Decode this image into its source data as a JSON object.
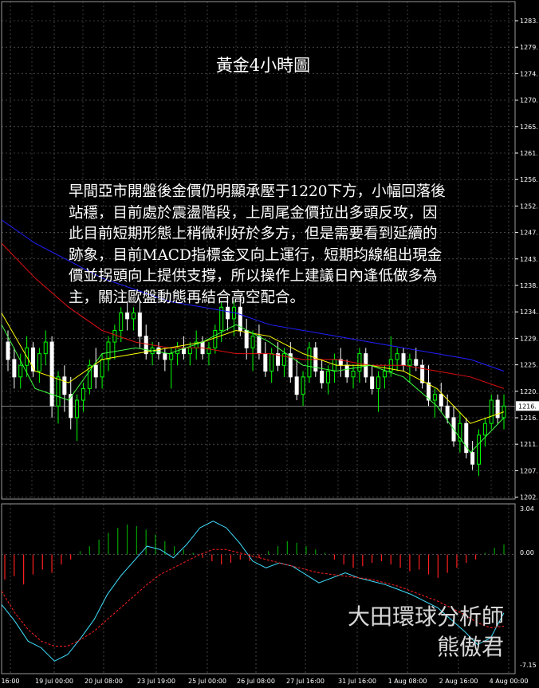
{
  "overlay": {
    "title": "黃金4小時圖",
    "commentary": "早間亞市開盤後金價仍明顯承壓于1220下方，小幅回落後\n站穩，目前處於震盪階段，上周尾金價拉出多頭反攻，因\n此目前短期形態上稍微利好於多方，但是需要看到延續的\n跡象，目前MACD指標金叉向上運行，短期均線組出現金\n價並拐頭向上提供支撐，所以操作上建議日內逢低做多為\n主，關注歐盤動態再結合高空配合。",
    "watermark_line1": "大田環球分析師",
    "watermark_line2": "熊傲君"
  },
  "colors": {
    "background": "#000000",
    "grid": "#707070",
    "bull_candle": "#00ff00",
    "bear_candle": "#ffffff",
    "ma_blue": "#2020ff",
    "ma_red": "#e01010",
    "ma_yellow": "#ffff00",
    "ma_green": "#40ff40",
    "macd_pos": "#00a000",
    "macd_neg": "#ff2020",
    "macd_main": "#40e0ff",
    "macd_signal": "#ff2020",
    "axis_text": "#ffffff",
    "current_price_line": "#c0c0c0"
  },
  "chart_data": {
    "type": "line",
    "price_axis": {
      "ticks": [
        "1283.",
        "1279.",
        "1274.",
        "1270.",
        "1265.",
        "1261.",
        "1256.",
        "1252.",
        "1247.",
        "1243.",
        "1238.",
        "1234.",
        "1229.",
        "1225.",
        "1220.",
        "1216.",
        "1211.",
        "1207.",
        "1202."
      ],
      "ylim": [
        1200,
        1285
      ],
      "current_price_label": "1216."
    },
    "macd_axis": {
      "ticks": [
        "3.04",
        "0.00",
        "-7.15"
      ],
      "ylim": [
        -7.15,
        3.04
      ]
    },
    "time_axis": [
      "16:00",
      "19 Jul 00:00",
      "20 Jul 08:00",
      "23 Jul 19:00",
      "25 Jul 00:00",
      "26 Jul 08:00",
      "27 Jul 16:00",
      "31 Jul 16:00",
      "1 Aug 08:00",
      "2 Aug 16:00",
      "4 Aug 00:00"
    ],
    "candles": [
      [
        1227,
        1229,
        1222,
        1224
      ],
      [
        1224,
        1226,
        1219,
        1221
      ],
      [
        1221,
        1225,
        1219,
        1223
      ],
      [
        1223,
        1228,
        1221,
        1226
      ],
      [
        1226,
        1227,
        1221,
        1222
      ],
      [
        1222,
        1226,
        1220,
        1225
      ],
      [
        1225,
        1229,
        1223,
        1227
      ],
      [
        1227,
        1228,
        1214,
        1216
      ],
      [
        1216,
        1222,
        1213,
        1221
      ],
      [
        1221,
        1223,
        1215,
        1218
      ],
      [
        1218,
        1221,
        1212,
        1214
      ],
      [
        1214,
        1218,
        1210,
        1217
      ],
      [
        1217,
        1220,
        1215,
        1219
      ],
      [
        1219,
        1224,
        1218,
        1223
      ],
      [
        1223,
        1226,
        1219,
        1221
      ],
      [
        1221,
        1225,
        1219,
        1224
      ],
      [
        1224,
        1228,
        1222,
        1227
      ],
      [
        1227,
        1230,
        1224,
        1229
      ],
      [
        1229,
        1233,
        1227,
        1232
      ],
      [
        1232,
        1234,
        1229,
        1231
      ],
      [
        1231,
        1233,
        1229,
        1232
      ],
      [
        1232,
        1234,
        1226,
        1228
      ],
      [
        1228,
        1230,
        1224,
        1225
      ],
      [
        1225,
        1227,
        1223,
        1226
      ],
      [
        1226,
        1227,
        1224,
        1225
      ],
      [
        1225,
        1226,
        1222,
        1224
      ],
      [
        1224,
        1226,
        1219,
        1225
      ],
      [
        1225,
        1227,
        1223,
        1226
      ],
      [
        1226,
        1228,
        1224,
        1225
      ],
      [
        1225,
        1227,
        1223,
        1226
      ],
      [
        1226,
        1229,
        1224,
        1227
      ],
      [
        1227,
        1228,
        1224,
        1225
      ],
      [
        1225,
        1227,
        1223,
        1226
      ],
      [
        1226,
        1230,
        1225,
        1229
      ],
      [
        1229,
        1234,
        1227,
        1233
      ],
      [
        1233,
        1235,
        1229,
        1231
      ],
      [
        1231,
        1234,
        1228,
        1233
      ],
      [
        1233,
        1235,
        1228,
        1229
      ],
      [
        1229,
        1231,
        1224,
        1226
      ],
      [
        1226,
        1229,
        1222,
        1228
      ],
      [
        1228,
        1230,
        1224,
        1225
      ],
      [
        1225,
        1227,
        1221,
        1222
      ],
      [
        1222,
        1226,
        1220,
        1225
      ],
      [
        1225,
        1227,
        1222,
        1223
      ],
      [
        1223,
        1226,
        1221,
        1225
      ],
      [
        1225,
        1227,
        1220,
        1221
      ],
      [
        1221,
        1224,
        1217,
        1218
      ],
      [
        1218,
        1222,
        1216,
        1221
      ],
      [
        1221,
        1227,
        1220,
        1226
      ],
      [
        1226,
        1227,
        1221,
        1222
      ],
      [
        1222,
        1224,
        1219,
        1220
      ],
      [
        1220,
        1223,
        1218,
        1222
      ],
      [
        1222,
        1225,
        1220,
        1224
      ],
      [
        1224,
        1226,
        1221,
        1223
      ],
      [
        1223,
        1224,
        1220,
        1221
      ],
      [
        1221,
        1223,
        1219,
        1222
      ],
      [
        1222,
        1226,
        1220,
        1225
      ],
      [
        1225,
        1226,
        1220,
        1221
      ],
      [
        1221,
        1223,
        1218,
        1219
      ],
      [
        1219,
        1222,
        1215,
        1221
      ],
      [
        1221,
        1223,
        1219,
        1222
      ],
      [
        1222,
        1228,
        1221,
        1224
      ],
      [
        1224,
        1226,
        1222,
        1225
      ],
      [
        1225,
        1226,
        1222,
        1223
      ],
      [
        1223,
        1225,
        1220,
        1224
      ],
      [
        1224,
        1226,
        1222,
        1223
      ],
      [
        1223,
        1224,
        1219,
        1220
      ],
      [
        1220,
        1223,
        1216,
        1217
      ],
      [
        1217,
        1219,
        1214,
        1218
      ],
      [
        1218,
        1220,
        1215,
        1216
      ],
      [
        1216,
        1218,
        1213,
        1214
      ],
      [
        1214,
        1216,
        1209,
        1210
      ],
      [
        1210,
        1215,
        1208,
        1213
      ],
      [
        1213,
        1214,
        1207,
        1208
      ],
      [
        1208,
        1210,
        1205,
        1206
      ],
      [
        1206,
        1212,
        1204,
        1211
      ],
      [
        1211,
        1214,
        1209,
        1213
      ],
      [
        1213,
        1218,
        1212,
        1217
      ],
      [
        1217,
        1218,
        1213,
        1214
      ],
      [
        1214,
        1218,
        1212,
        1216
      ]
    ],
    "series": [
      {
        "color_key": "ma_blue",
        "values": [
          1248,
          1244,
          1241,
          1238,
          1236,
          1234,
          1233,
          1232,
          1230,
          1229,
          1228,
          1227,
          1226,
          1225,
          1224,
          1222
        ]
      },
      {
        "color_key": "ma_red",
        "values": [
          1244,
          1238,
          1233,
          1229,
          1227,
          1226,
          1226,
          1225,
          1225,
          1224,
          1224,
          1223,
          1223,
          1222,
          1221,
          1219
        ]
      },
      {
        "color_key": "ma_yellow",
        "values": [
          1232,
          1222,
          1220,
          1224,
          1225,
          1226,
          1227,
          1229,
          1228,
          1225,
          1223,
          1223,
          1222,
          1219,
          1213,
          1215
        ]
      },
      {
        "color_key": "ma_green",
        "values": [
          1230,
          1219,
          1217,
          1225,
          1226,
          1225,
          1227,
          1230,
          1227,
          1223,
          1222,
          1223,
          1221,
          1216,
          1208,
          1214
        ]
      }
    ],
    "macd_histogram": [
      -1.5,
      -1.3,
      -1.8,
      -1.2,
      -0.9,
      -1.1,
      -0.6,
      -0.3,
      0.2,
      0.5,
      0.9,
      1.3,
      1.6,
      1.8,
      1.7,
      1.5,
      1.2,
      0.8,
      0.5,
      0.3,
      0.1,
      -0.2,
      -0.4,
      -0.6,
      -0.5,
      -0.3,
      -0.4,
      -0.2,
      0.2,
      0.5,
      0.8,
      0.7,
      0.5,
      0.3,
      0.1,
      -0.3,
      -0.6,
      -0.8,
      -0.7,
      -0.5,
      -0.4,
      -0.6,
      -0.8,
      -1.0,
      -0.9,
      -1.2,
      -1.4,
      -1.1,
      -0.8,
      -0.5,
      -0.3,
      0.1,
      0.4,
      0.6
    ],
    "macd_main": [
      -3.0,
      -4.0,
      -5.2,
      -5.6,
      -6.4,
      -6.0,
      -5.0,
      -3.9,
      -2.4,
      -1.3,
      -0.4,
      0.5,
      0.3,
      -0.2,
      0.6,
      1.6,
      2.0,
      1.6,
      0.7,
      -0.4,
      -0.8,
      -0.5,
      -0.7,
      -1.2,
      -1.7,
      -1.4,
      -1.1,
      -1.4,
      -1.6,
      -1.8,
      -2.1,
      -2.4,
      -2.8,
      -3.2,
      -3.9,
      -4.6,
      -5.4,
      -5.0,
      -3.5
    ],
    "macd_signal": [
      -2.2,
      -3.5,
      -4.5,
      -5.2,
      -5.5,
      -5.5,
      -5.1,
      -4.6,
      -3.9,
      -3.2,
      -2.5,
      -1.8,
      -1.2,
      -0.8,
      -0.4,
      0.0,
      0.3,
      0.3,
      0.1,
      -0.1,
      -0.3,
      -0.5,
      -0.7,
      -0.9,
      -1.1,
      -1.2,
      -1.3,
      -1.4,
      -1.5,
      -1.7,
      -1.9,
      -2.2,
      -2.5,
      -2.8,
      -3.2,
      -3.6,
      -4.1,
      -4.4,
      -4.3
    ]
  }
}
